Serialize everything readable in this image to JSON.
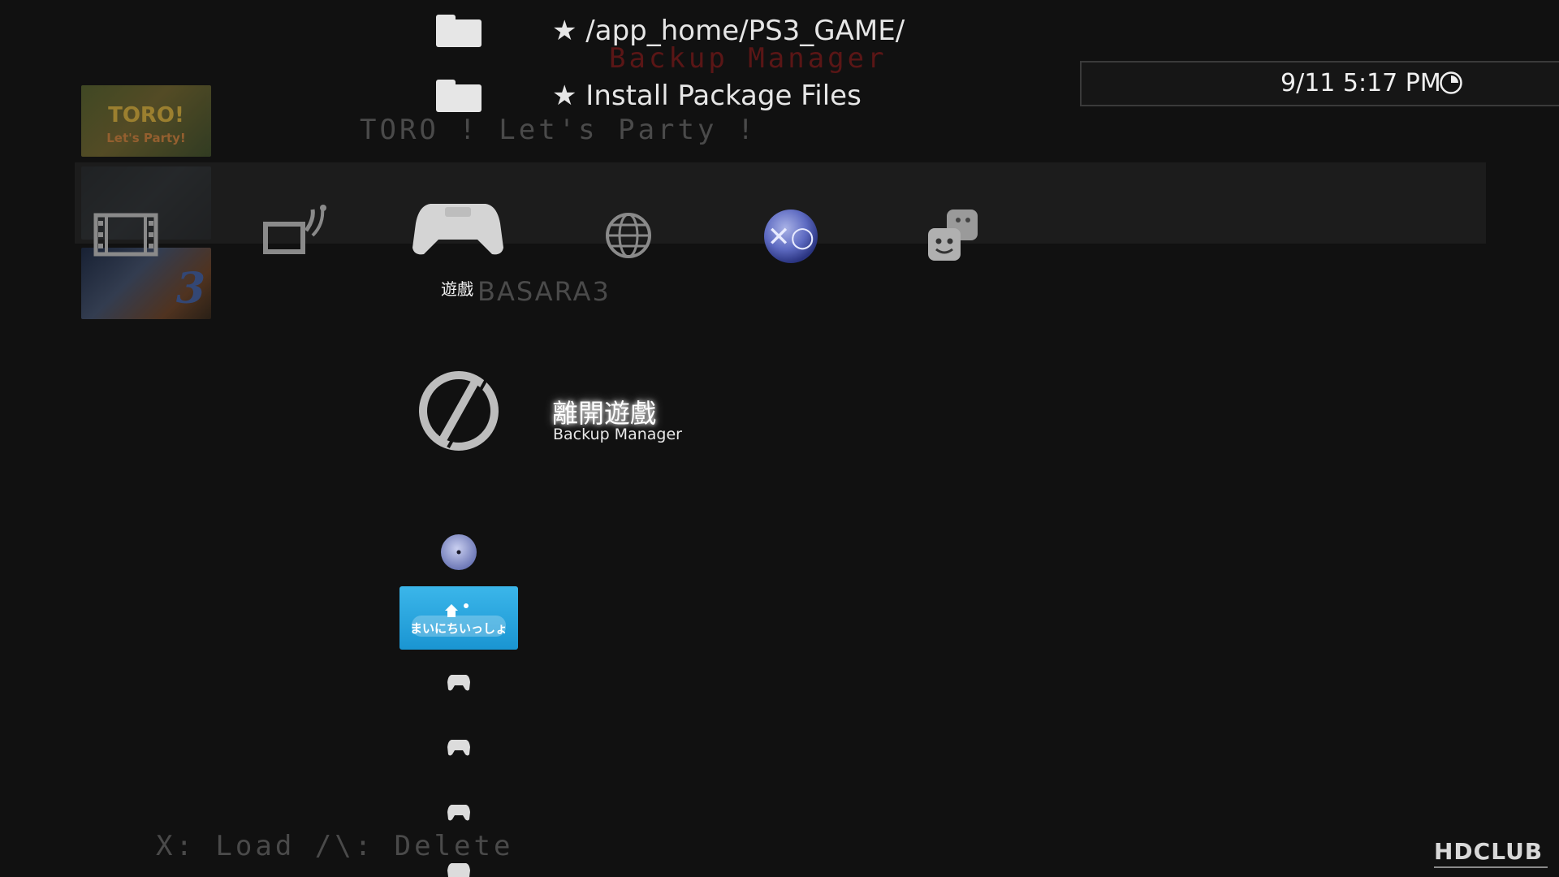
{
  "top_items": [
    {
      "label": "★ /app_home/PS3_GAME/",
      "icon": "folder-icon"
    },
    {
      "label": "★ Install Package Files",
      "icon": "folder-icon"
    }
  ],
  "background_app": {
    "title_ghost": "Backup Manager",
    "game_name_ghost": "TORO ! Let's Party !",
    "basara_ghost": "BASARA3",
    "hint_text": "X: Load   /\\: Delete",
    "thumb_labels": [
      "TORO! Let's Party!",
      "BASARA3"
    ]
  },
  "clock": {
    "time": "9/11 5:17 PM"
  },
  "xmb_categories": [
    {
      "name": "video",
      "icon": "film-icon"
    },
    {
      "name": "tv",
      "icon": "tv-icon"
    },
    {
      "name": "game",
      "icon": "controller-icon",
      "label": "遊戲",
      "selected": true
    },
    {
      "name": "network",
      "icon": "globe-icon"
    },
    {
      "name": "playstation-network",
      "icon": "psn-icon"
    },
    {
      "name": "friends",
      "icon": "friends-icon"
    }
  ],
  "selected_item": {
    "title": "離開遊戲",
    "subtitle": "Backup Manager",
    "icon": "quit-icon"
  },
  "game_list": [
    {
      "icon": "disc-icon"
    },
    {
      "icon": "mainichi-issyo-icon",
      "thumb_text": "まいにちいっしょ"
    },
    {
      "icon": "controller-small-icon"
    },
    {
      "icon": "controller-small-icon"
    },
    {
      "icon": "controller-small-icon"
    },
    {
      "icon": "controller-small-icon"
    }
  ],
  "watermark": {
    "text": "HDCLUB"
  }
}
